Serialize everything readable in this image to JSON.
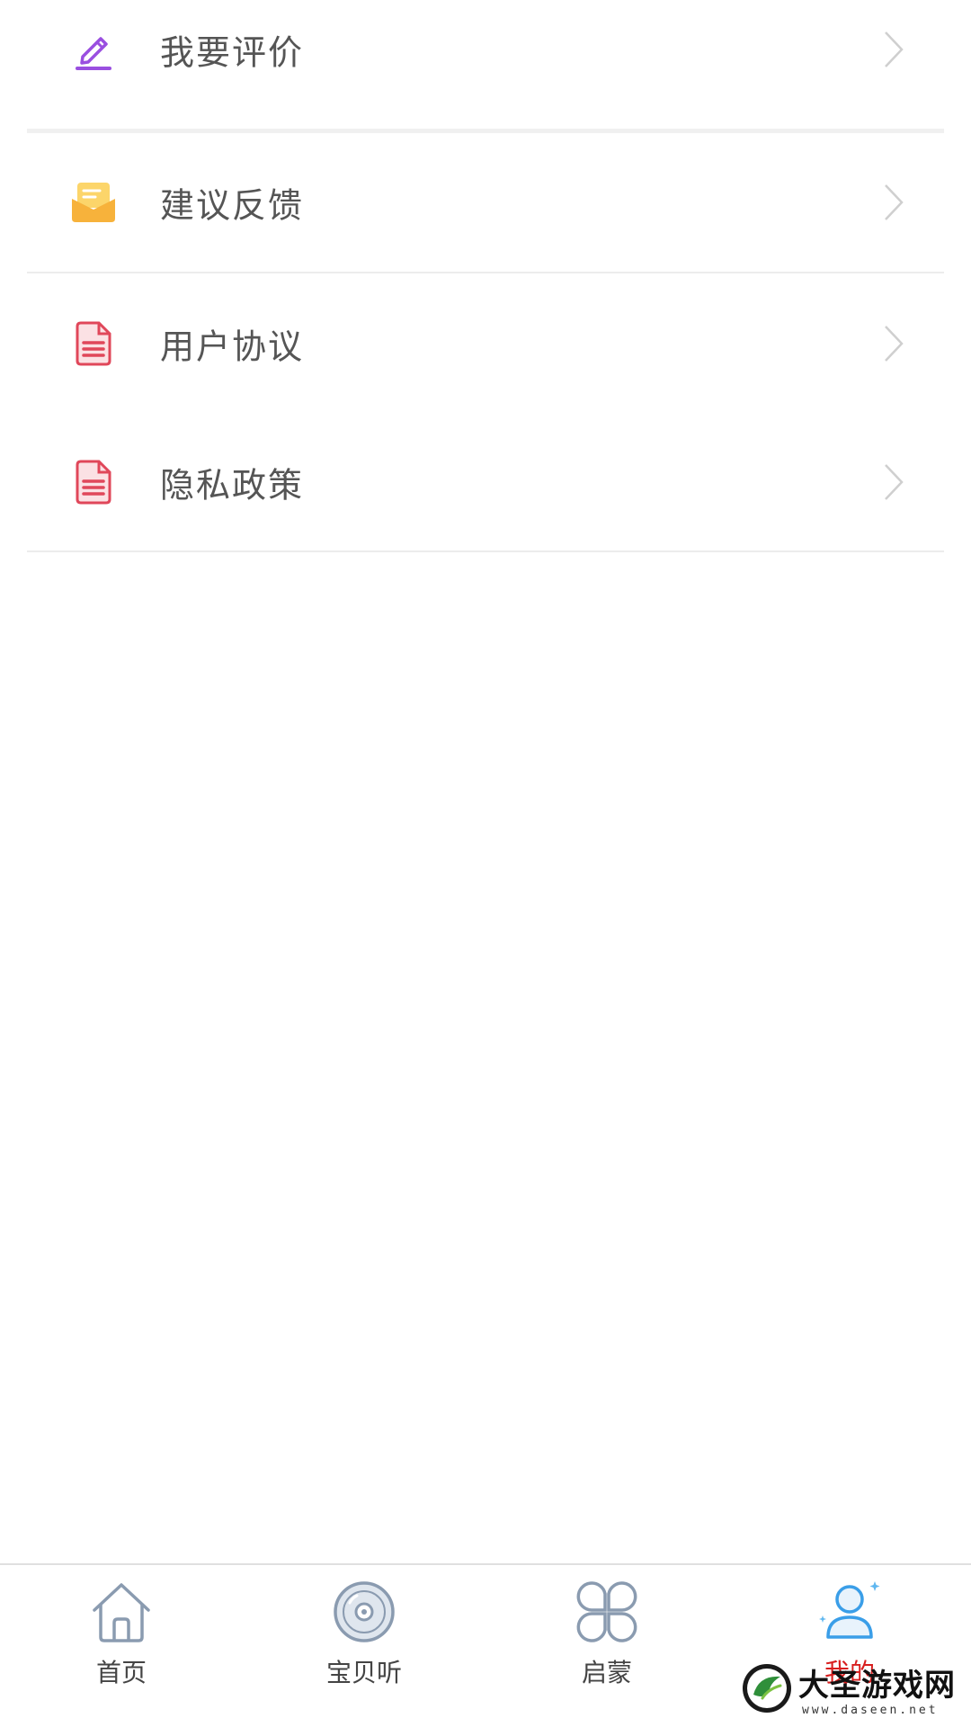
{
  "menu": {
    "items": [
      {
        "label": "我要评价",
        "icon": "pencil-icon"
      },
      {
        "label": "建议反馈",
        "icon": "mail-icon"
      },
      {
        "label": "用户协议",
        "icon": "document-icon"
      },
      {
        "label": "隐私政策",
        "icon": "document-icon"
      }
    ]
  },
  "tabbar": {
    "tabs": [
      {
        "label": "首页",
        "icon": "home-icon"
      },
      {
        "label": "宝贝听",
        "icon": "disc-icon"
      },
      {
        "label": "启蒙",
        "icon": "clover-icon"
      },
      {
        "label": "我的",
        "icon": "user-icon",
        "active": true
      }
    ]
  },
  "watermark": {
    "title": "大圣游戏网",
    "url": "www.daseen.net"
  },
  "colors": {
    "accent_active": "#d81e1e",
    "pencil": "#9a4fe0",
    "mail": "#f7b23b",
    "document": "#e0475a",
    "tab_icon": "#8a9bb0",
    "user_icon": "#3a9ee8"
  }
}
